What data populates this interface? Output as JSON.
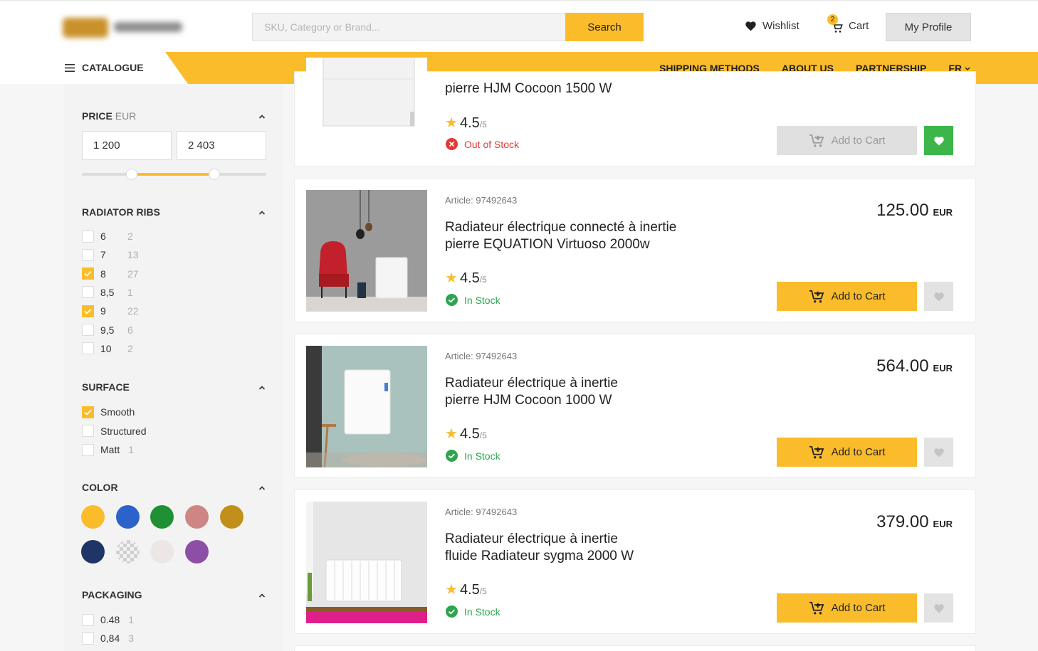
{
  "header": {
    "search_placeholder": "SKU, Category or Brand...",
    "search_button": "Search",
    "wishlist_label": "Wishlist",
    "cart_label": "Cart",
    "cart_count": "2",
    "profile_label": "My Profile"
  },
  "nav": {
    "catalogue_label": "CATALOGUE",
    "links": [
      "SHIPPING METHODS",
      "ABOUT US",
      "PARTNERSHIP",
      "FR"
    ]
  },
  "filters": {
    "price": {
      "title": "PRICE",
      "currency": "EUR",
      "min": "1 200",
      "max": "2 403",
      "slider_low_fraction": 0.27,
      "slider_high_fraction": 0.72
    },
    "ribs": {
      "title": "RADIATOR RIBS",
      "options": [
        {
          "label": "6",
          "count": "2",
          "checked": false
        },
        {
          "label": "7",
          "count": "13",
          "checked": false
        },
        {
          "label": "8",
          "count": "27",
          "checked": true
        },
        {
          "label": "8,5",
          "count": "1",
          "checked": false
        },
        {
          "label": "9",
          "count": "22",
          "checked": true
        },
        {
          "label": "9,5",
          "count": "6",
          "checked": false
        },
        {
          "label": "10",
          "count": "2",
          "checked": false
        }
      ]
    },
    "surface": {
      "title": "SURFACE",
      "options": [
        {
          "label": "Smooth",
          "count": "",
          "checked": true
        },
        {
          "label": "Structured",
          "count": "",
          "checked": false
        },
        {
          "label": "Matt",
          "count": "1",
          "checked": false
        }
      ]
    },
    "color": {
      "title": "COLOR",
      "swatches": [
        "#fbbc2c",
        "#2c62c9",
        "#1f9134",
        "#d08585",
        "#c1901a",
        "#1e3566",
        "checkered",
        "#ece6e4",
        "#8d4fa6"
      ]
    },
    "packaging": {
      "title": "PACKAGING",
      "options": [
        {
          "label": "0.48",
          "count": "1",
          "checked": false
        },
        {
          "label": "0,84",
          "count": "3",
          "checked": false
        }
      ]
    }
  },
  "products": [
    {
      "article": "",
      "title_line1": "pierre HJM Cocoon 1500 W",
      "title_line2": "",
      "rating": "4.5",
      "rating_max": "/5",
      "stock": "Out of Stock",
      "in_stock": false,
      "price": "",
      "currency": "",
      "add_label": "Add to Cart",
      "wished": true
    },
    {
      "article": "Article: 97492643",
      "title_line1": "Radiateur électrique connecté à inertie",
      "title_line2": "pierre EQUATION Virtuoso 2000w",
      "rating": "4.5",
      "rating_max": "/5",
      "stock": "In Stock",
      "in_stock": true,
      "price": "125.00",
      "currency": "EUR",
      "add_label": "Add to Cart",
      "wished": false
    },
    {
      "article": "Article: 97492643",
      "title_line1": "Radiateur électrique à inertie",
      "title_line2": "pierre HJM Cocoon 1000 W",
      "rating": "4.5",
      "rating_max": "/5",
      "stock": "In Stock",
      "in_stock": true,
      "price": "564.00",
      "currency": "EUR",
      "add_label": "Add to Cart",
      "wished": false
    },
    {
      "article": "Article: 97492643",
      "title_line1": "Radiateur électrique à inertie",
      "title_line2": "fluide Radiateur sygma 2000 W",
      "rating": "4.5",
      "rating_max": "/5",
      "stock": "In Stock",
      "in_stock": true,
      "price": "379.00",
      "currency": "EUR",
      "add_label": "Add to Cart",
      "wished": false
    }
  ]
}
